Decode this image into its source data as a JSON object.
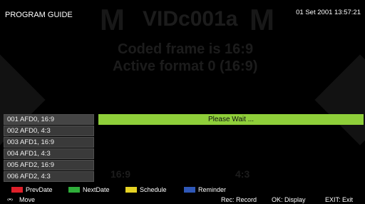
{
  "header": {
    "title": "PROGRAM GUIDE",
    "datetime": "01 Set 2001 13:57:21"
  },
  "background": {
    "logo_text": "VIDc001a",
    "big_letter": "M",
    "line1": "Coded frame is 16:9",
    "line2": "Active format 0 (16:9)",
    "aspect_left": "16:9",
    "aspect_right": "4:3"
  },
  "status": {
    "message": "Please Wait ..."
  },
  "channels": [
    {
      "label": "001  AFD0, 16:9"
    },
    {
      "label": "002  AFD0, 4:3"
    },
    {
      "label": "003  AFD1, 16:9"
    },
    {
      "label": "004  AFD1, 4:3"
    },
    {
      "label": "005  AFD2, 16:9"
    },
    {
      "label": "006  AFD2, 4:3"
    }
  ],
  "legend": {
    "prev": {
      "label": "PrevDate",
      "color": "#e0202a"
    },
    "next": {
      "label": "NextDate",
      "color": "#2fae3a"
    },
    "schedule": {
      "label": "Schedule",
      "color": "#e6d324"
    },
    "reminder": {
      "label": "Reminder",
      "color": "#2f58b8"
    }
  },
  "nav": {
    "move_icon": "move-arrows-icon",
    "move": "Move",
    "record": "Rec: Record",
    "display": "OK: Display",
    "exit": "EXIT: Exit"
  }
}
